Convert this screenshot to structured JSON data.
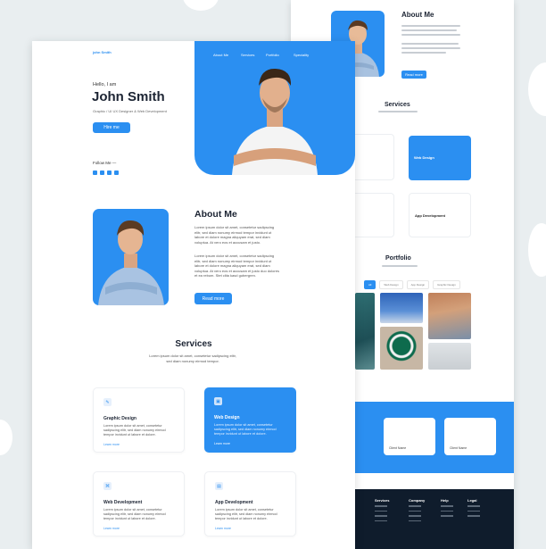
{
  "front": {
    "logo": "john Smith",
    "nav": [
      "About Me",
      "Services",
      "Portfolio",
      "Speciality"
    ],
    "hero": {
      "greeting": "Hello, I am",
      "name": "John Smith",
      "role": "Graphic / UI UX Designer & Web Development",
      "hire_label": "Hire me",
      "follow_label": "Follow Me —"
    },
    "about": {
      "title": "About Me",
      "para1": "Lorem ipsum dolor sit amet, consetetur sadipscing elitr, sed diam nonumy eirmod tempor invidunt ut labore et dolore magna aliquyam erat, sed diam voluptua. At vero eos et accusam et justo.",
      "para2": "Lorem ipsum dolor sit amet, consetetur sadipscing elitr, sed diam nonumy eirmod tempor invidunt ut labore et dolore magna aliquyam erat, sed diam voluptua. At vero eos et accusam et justo duo dolores et ea rebum. Stet clita kasd gubergren.",
      "read_more": "Read more"
    },
    "services": {
      "title": "Services",
      "subtitle": "Lorem ipsum dolor sit amet, consetetur sadipscing elitr, sed diam nonumy eirmod tempor.",
      "cards": [
        {
          "title": "Graphic Design",
          "desc": "Lorem ipsum dolor sit amet, consetetur sadipscing elitr, sed diam nonumy eirmod tempor invidunt ut labore et dolore.",
          "link": "Learn more"
        },
        {
          "title": "Web Design",
          "desc": "Lorem ipsum dolor sit amet, consetetur sadipscing elitr, sed diam nonumy eirmod tempor invidunt ut labore et dolore.",
          "link": "Learn more"
        },
        {
          "title": "Web Development",
          "desc": "Lorem ipsum dolor sit amet, consetetur sadipscing elitr, sed diam nonumy eirmod tempor invidunt ut labore et dolore.",
          "link": "Learn more"
        },
        {
          "title": "App Development",
          "desc": "Lorem ipsum dolor sit amet, consetetur sadipscing elitr, sed diam nonumy eirmod tempor invidunt ut labore et dolore.",
          "link": "Learn more"
        }
      ]
    }
  },
  "back": {
    "about_title": "About Me",
    "read_more": "Read more",
    "services_title": "Services",
    "services_cards": [
      "Web Design",
      "App Development"
    ],
    "portfolio_title": "Portfolio",
    "portfolio_tabs": [
      "All",
      "Web Design",
      "App Design",
      "Graphic Design"
    ],
    "testimonial_names": [
      "Client Name",
      "Client Name"
    ],
    "footer_cols": [
      "Services",
      "Company",
      "Help",
      "Legal"
    ]
  },
  "colors": {
    "accent": "#2b8ff1",
    "dark": "#1c2433",
    "footer": "#0f1c2c"
  }
}
